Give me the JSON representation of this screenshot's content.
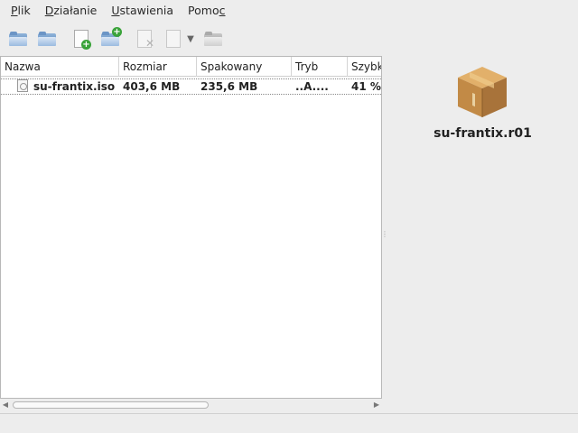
{
  "menu": {
    "items": [
      {
        "first": "P",
        "rest": "lik"
      },
      {
        "first": "D",
        "rest": "ziałanie"
      },
      {
        "first": "U",
        "rest": "stawienia"
      },
      {
        "first": "Pomo",
        "rest": "c"
      }
    ]
  },
  "filelist": {
    "columns": [
      "Nazwa",
      "Rozmiar",
      "Spakowany",
      "Tryb",
      "Szybk"
    ],
    "rows": [
      {
        "name": "su-frantix.iso",
        "size": "403,6 MB",
        "packed": "235,6 MB",
        "mode": "..A....",
        "speed": "41 %"
      }
    ]
  },
  "scrollbar": {
    "thumb_fraction": 0.55
  },
  "preview": {
    "archive_name": "su-frantix.r01"
  },
  "icons": {
    "toolbar": [
      "open-folder-icon",
      "extract-folder-icon",
      "add-file-icon",
      "add-folder-icon",
      "delete-file-icon",
      "archive-info-icon",
      "dropdown-arrow-icon",
      "close-archive-icon"
    ],
    "archive": "package-box-icon"
  },
  "colors": {
    "folder_blue": "#4f7fb8",
    "box_brown": "#c8924f"
  }
}
